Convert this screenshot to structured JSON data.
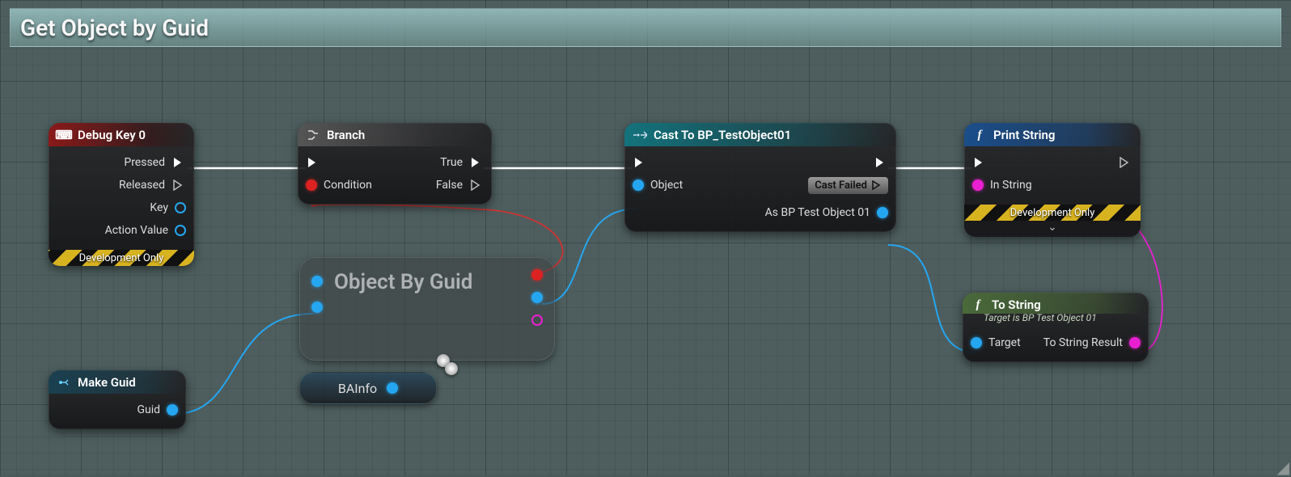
{
  "header": {
    "title": "Get Object by Guid"
  },
  "nodes": {
    "debugkey": {
      "title": "Debug Key 0",
      "pins": {
        "pressed": "Pressed",
        "released": "Released",
        "key": "Key",
        "action_value": "Action Value"
      },
      "hazard": "Development Only"
    },
    "branch": {
      "title": "Branch",
      "pins": {
        "condition": "Condition",
        "true": "True",
        "false": "False"
      }
    },
    "objbyguid": {
      "title": "Object By Guid"
    },
    "bainfo": {
      "label": "BAInfo"
    },
    "makeguid": {
      "title": "Make Guid",
      "pins": {
        "guid": "Guid"
      }
    },
    "cast": {
      "title": "Cast To BP_TestObject01",
      "pins": {
        "object": "Object",
        "castfailed": "Cast Failed",
        "asbp": "As BP Test Object 01"
      }
    },
    "print": {
      "title": "Print String",
      "pins": {
        "instring": "In String"
      },
      "hazard": "Development Only"
    },
    "tostring": {
      "title": "To String",
      "subtitle": "Target is BP Test Object 01",
      "pins": {
        "target": "Target",
        "result": "To String Result"
      }
    }
  }
}
